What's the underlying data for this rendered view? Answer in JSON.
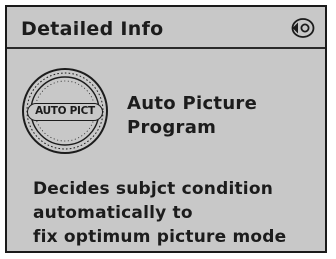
{
  "header": {
    "title": "Detailed Info",
    "mode_icon": "scene-mode-icon"
  },
  "dial": {
    "label": "AUTO PICT",
    "icon": "mode-dial-icon"
  },
  "mode": {
    "name_lines": [
      "Auto Picture",
      "Program"
    ]
  },
  "description": {
    "lines": [
      "Decides subjct condition",
      "automatically to",
      "fix optimum picture mode"
    ]
  },
  "colors": {
    "background": "#c8c8c8",
    "text": "#1c1c1c",
    "border": "#1a1a1a"
  }
}
